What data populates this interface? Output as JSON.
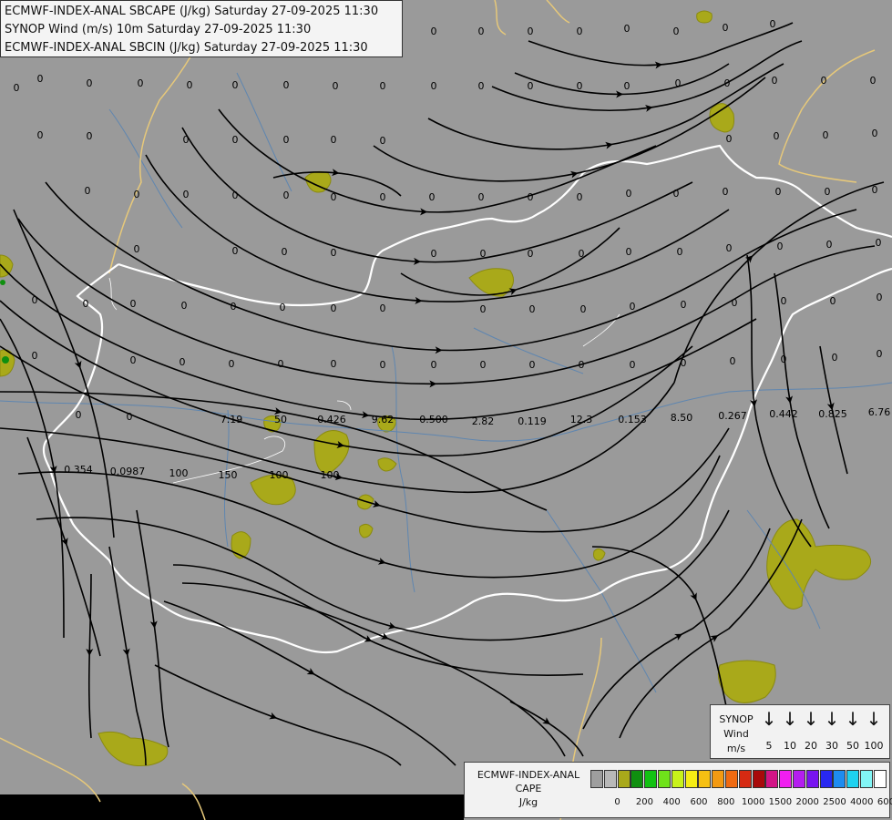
{
  "header": {
    "line1": "ECMWF-INDEX-ANAL SBCAPE (J/kg) Saturday 27-09-2025 11:30",
    "line2": "SYNOP Wind (m/s) 10m Saturday 27-09-2025 11:30",
    "line3": "ECMWF-INDEX-ANAL SBCIN (J/kg) Saturday 27-09-2025 11:30"
  },
  "map_values": [
    "0",
    "0",
    "0",
    "0",
    "0",
    "0",
    "0",
    "0",
    "0",
    "0",
    "0",
    "0",
    "0",
    "0",
    "0",
    "0",
    "0",
    "0",
    "0",
    "0",
    "0",
    "0",
    "0",
    "0",
    "0",
    "0",
    "0",
    "0",
    "0",
    "0",
    "0",
    "0",
    "0",
    "0",
    "0",
    "0",
    "0",
    "0",
    "0",
    "0",
    "0",
    "0",
    "0",
    "0",
    "0",
    "0",
    "0",
    "0",
    "0",
    "0",
    "0",
    "0",
    "0",
    "0",
    "0",
    "0",
    "0",
    "0",
    "0",
    "0",
    "0",
    "0",
    "0",
    "0",
    "0",
    "0",
    "0",
    "0",
    "0",
    "0",
    "0",
    "0",
    "0",
    "0",
    "0",
    "0",
    "0",
    "0",
    "0",
    "0",
    "0",
    "0",
    "0",
    "0",
    "0",
    "0",
    "0",
    "0",
    "0",
    "0",
    "0",
    "0",
    "0",
    "0",
    "0",
    "0",
    "0",
    "0",
    "0",
    "0",
    "0",
    "0",
    "0",
    "0",
    "0",
    "0",
    "7.19",
    "50",
    "0.426",
    "9.62",
    "0.500",
    "2.82",
    "0.119",
    "12.3",
    "0.153",
    "8.50",
    "0.267",
    "0.442",
    "0.825",
    "6.76",
    "0.354",
    "0.0987",
    "100",
    "150",
    "100",
    "100"
  ],
  "wind_legend": {
    "title_lines": [
      "SYNOP",
      "Wind",
      "m/s"
    ],
    "speeds": [
      "5",
      "10",
      "20",
      "30",
      "50",
      "100"
    ]
  },
  "cape_legend": {
    "title_lines": [
      "ECMWF-INDEX-ANAL",
      "CAPE",
      "J/kg"
    ],
    "ticks": [
      "0",
      "200",
      "400",
      "600",
      "800",
      "1000",
      "1500",
      "2000",
      "2500",
      "4000",
      "6000"
    ],
    "colors": [
      "#9e9e9e",
      "#b8b8b8",
      "#a9a91a",
      "#0f8f0f",
      "#12c212",
      "#6fe21a",
      "#c8f21a",
      "#f5ed14",
      "#f6c012",
      "#f39a12",
      "#ef6a12",
      "#d62a12",
      "#a80a0a",
      "#d21586",
      "#f01ef0",
      "#b41ef0",
      "#7814f0",
      "#2828f0",
      "#1e8cf0",
      "#1ed2f0",
      "#82f5f5",
      "#ffffff"
    ]
  },
  "colors": {
    "background": "#9a9a9a",
    "cape_low": "#a9a91a",
    "border_country": "#ffffff",
    "border_outer": "#e6c87a",
    "rivers": "#5f86b0",
    "streamline": "#000000"
  }
}
